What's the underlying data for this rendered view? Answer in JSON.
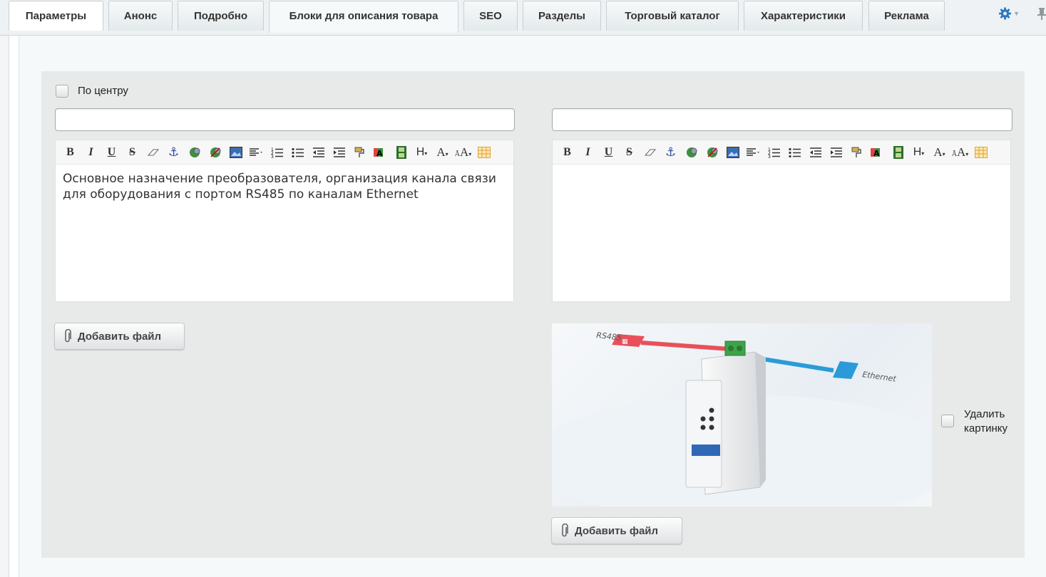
{
  "tabs": [
    {
      "label": "Параметры"
    },
    {
      "label": "Анонс"
    },
    {
      "label": "Подробно"
    },
    {
      "label": "Блоки для описания товара"
    },
    {
      "label": "SEO"
    },
    {
      "label": "Разделы"
    },
    {
      "label": "Торговый каталог"
    },
    {
      "label": "Характеристики"
    },
    {
      "label": "Реклама"
    }
  ],
  "active_tab": "Блоки для описания товара",
  "icons": {
    "settings": "gear-icon",
    "pin": "pin-icon"
  },
  "center_checkbox": {
    "label": "По центру",
    "checked": false
  },
  "left_block": {
    "title_value": "",
    "editor_text": "Основное назначение преобразователя, организация канала связи\nдля оборудования с портом RS485 по каналам Ethernet",
    "add_file_label": "Добавить файл"
  },
  "right_block": {
    "title_value": "",
    "editor_text": "",
    "image_labels": {
      "left": "RS485",
      "right": "Ethernet"
    },
    "delete_picture_label": "Удалить\nкартинку",
    "delete_picture_checked": false,
    "add_file_label": "Добавить файл"
  },
  "toolbar_buttons": [
    "bold",
    "italic",
    "underline",
    "strikethrough",
    "remove-format",
    "anchor",
    "insert-link",
    "remove-link",
    "insert-image",
    "align",
    "ordered-list",
    "unordered-list",
    "outdent",
    "indent",
    "copy-format",
    "background-color",
    "insert-video",
    "heading",
    "font-size",
    "font-color",
    "insert-table"
  ],
  "colors": {
    "accent_gear": "#2d78c4",
    "panel_bg": "#e8e9e9",
    "rs485_red": "#e8505b",
    "ethernet_blue": "#2a9bd8"
  }
}
